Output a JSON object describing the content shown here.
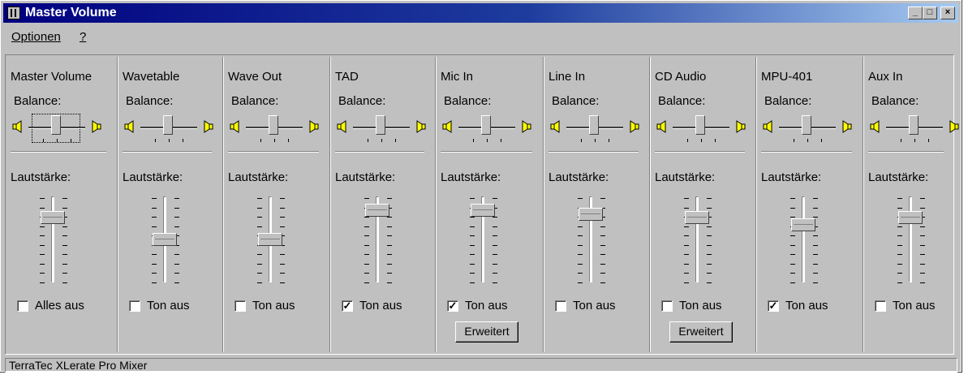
{
  "window": {
    "title": "Master Volume",
    "controls": {
      "minimize": "_",
      "maximize": "□",
      "close": "×"
    }
  },
  "menu": {
    "items": [
      "Optionen",
      "?"
    ]
  },
  "mixer": {
    "channels": [
      {
        "name": "Master Volume",
        "balance_label": "Balance:",
        "volume_label": "Lautstärke:",
        "volume_level": 0.8,
        "checkbox_label": "Alles aus",
        "checked": false,
        "button": ""
      },
      {
        "name": "Wavetable",
        "balance_label": "Balance:",
        "volume_label": "Lautstärke:",
        "volume_level": 0.5,
        "checkbox_label": "Ton aus",
        "checked": false,
        "button": ""
      },
      {
        "name": "Wave Out",
        "balance_label": "Balance:",
        "volume_label": "Lautstärke:",
        "volume_level": 0.5,
        "checkbox_label": "Ton aus",
        "checked": false,
        "button": ""
      },
      {
        "name": "TAD",
        "balance_label": "Balance:",
        "volume_label": "Lautstärke:",
        "volume_level": 0.9,
        "checkbox_label": "Ton aus",
        "checked": true,
        "button": ""
      },
      {
        "name": "Mic In",
        "balance_label": "Balance:",
        "volume_label": "Lautstärke:",
        "volume_level": 0.9,
        "checkbox_label": "Ton aus",
        "checked": true,
        "button": "Erweitert"
      },
      {
        "name": "Line In",
        "balance_label": "Balance:",
        "volume_label": "Lautstärke:",
        "volume_level": 0.85,
        "checkbox_label": "Ton aus",
        "checked": false,
        "button": ""
      },
      {
        "name": "CD Audio",
        "balance_label": "Balance:",
        "volume_label": "Lautstärke:",
        "volume_level": 0.8,
        "checkbox_label": "Ton aus",
        "checked": false,
        "button": "Erweitert"
      },
      {
        "name": "MPU-401",
        "balance_label": "Balance:",
        "volume_label": "Lautstärke:",
        "volume_level": 0.7,
        "checkbox_label": "Ton aus",
        "checked": true,
        "button": ""
      },
      {
        "name": "Aux In",
        "balance_label": "Balance:",
        "volume_label": "Lautstärke:",
        "volume_level": 0.8,
        "checkbox_label": "Ton aus",
        "checked": false,
        "button": ""
      }
    ]
  },
  "status": {
    "text": "TerraTec XLerate Pro Mixer"
  },
  "colors": {
    "face": "#c0c0c0",
    "title_start": "#000080",
    "title_end": "#a6caf0"
  }
}
